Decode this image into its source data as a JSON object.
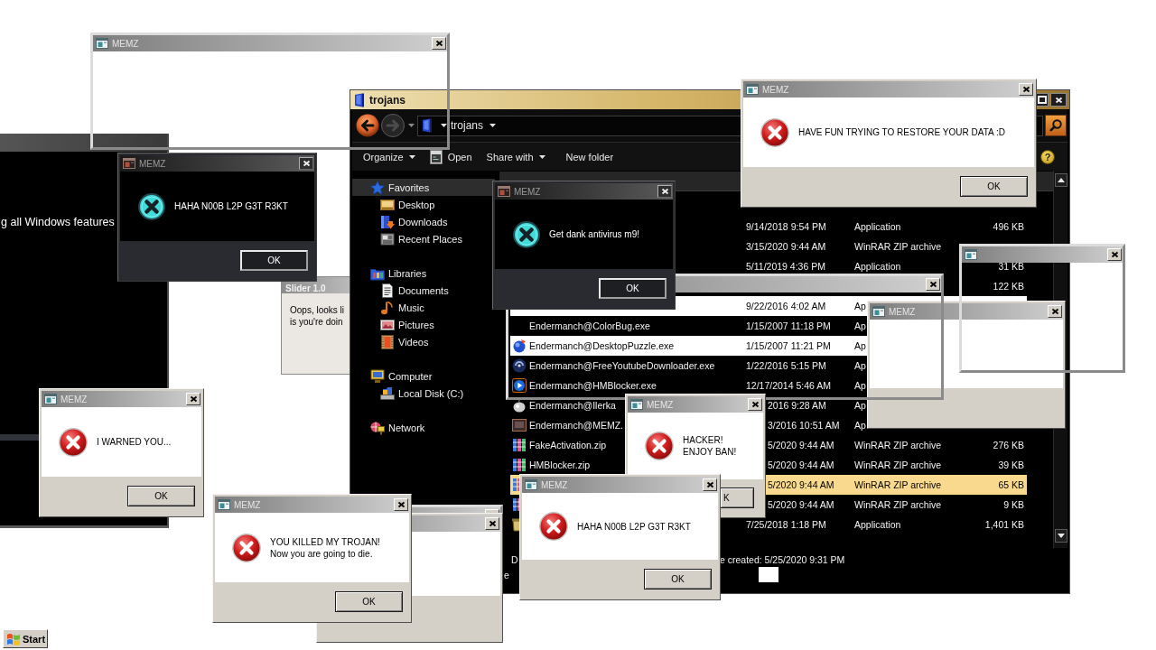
{
  "desktop": {
    "windows": [
      {
        "kind": "console",
        "text": "g all Windows features"
      },
      {
        "kind": "slider",
        "title": "Slider 1.0",
        "lines": [
          "Oops, looks li",
          "is you're doin"
        ]
      },
      {
        "kind": "explorer",
        "title": "trojans",
        "address": "trojans",
        "commands": [
          {
            "label": "Organize",
            "kind": "menu"
          },
          {
            "label": "Open",
            "kind": "action"
          },
          {
            "label": "Share with",
            "kind": "menu"
          },
          {
            "label": "New folder",
            "kind": "plain"
          }
        ],
        "help": "?",
        "navigation": [
          {
            "label": "Favorites",
            "selected": true,
            "children": [
              {
                "label": "Desktop",
                "selected": false
              },
              {
                "label": "Downloads",
                "selected": false
              },
              {
                "label": "Recent Places",
                "selected": false
              }
            ]
          },
          {
            "label": "Libraries",
            "selected": false,
            "children": [
              {
                "label": "Documents",
                "selected": false
              },
              {
                "label": "Music",
                "selected": false
              },
              {
                "label": "Pictures",
                "selected": false
              },
              {
                "label": "Videos",
                "selected": false
              }
            ]
          },
          {
            "label": "Computer",
            "selected": false,
            "children": [
              {
                "label": "Local Disk (C:)",
                "selected": false
              }
            ]
          },
          {
            "label": "Network",
            "selected": false
          }
        ],
        "rows": [
          {
            "kind": "plain",
            "selected": false,
            "glitched": false,
            "column_2": "9/14/2018 9:54 PM",
            "column_3": "Application",
            "column_4": "496 KB"
          },
          {
            "kind": "plain",
            "selected": false,
            "glitched": false,
            "column_2": "3/15/2020 9:44 AM",
            "column_3": "WinRAR ZIP archive"
          },
          {
            "kind": "plain",
            "selected": false,
            "glitched": false,
            "column_2": "5/11/2019 4:36 PM",
            "column_3": "Application",
            "column_4": "31 KB"
          },
          {
            "kind": "plain",
            "selected": false,
            "glitched": false,
            "column_4": "122 KB"
          },
          {
            "kind": "plain",
            "selected": false,
            "glitched": true,
            "column_2": "9/22/2016 4:02 AM",
            "column_3": "Ap"
          },
          {
            "kind": "plain",
            "selected": false,
            "glitched": false,
            "column_1": "Endermanch@ColorBug.exe",
            "column_2": "1/15/2007 11:18 PM",
            "column_3": "Ap"
          },
          {
            "kind": "app",
            "selected": false,
            "glitched": true,
            "column_1": "Endermanch@DesktopPuzzle.exe",
            "column_2": "1/15/2007 11:21 PM",
            "column_3": "Ap"
          },
          {
            "kind": "app",
            "selected": false,
            "glitched": false,
            "column_1": "Endermanch@FreeYoutubeDownloader.exe",
            "column_2": "1/22/2016 5:15 PM",
            "column_3": "Ap"
          },
          {
            "kind": "app",
            "selected": false,
            "glitched": false,
            "column_1": "Endermanch@HMBlocker.exe",
            "column_2": "12/17/2014 5:46 AM",
            "column_3": "Ap"
          },
          {
            "kind": "app",
            "selected": false,
            "glitched": false,
            "column_1": "Endermanch@Ilerka",
            "column_2": "2016 9:28 AM",
            "column_3": "Ap"
          },
          {
            "kind": "app",
            "selected": false,
            "glitched": false,
            "column_1": "Endermanch@MEMZ.",
            "column_2": "3/2016 10:51 AM",
            "column_3": "Ap"
          },
          {
            "kind": "archive",
            "selected": false,
            "glitched": false,
            "column_1": "FakeActivation.zip",
            "column_2": "5/2020 9:44 AM",
            "column_3": "WinRAR ZIP archive",
            "column_4": "276 KB"
          },
          {
            "kind": "archive",
            "selected": false,
            "glitched": false,
            "column_1": "HMBlocker.zip",
            "column_2": "5/2020 9:44 AM",
            "column_3": "WinRAR ZIP archive",
            "column_4": "39 KB"
          },
          {
            "kind": "archive",
            "selected": true,
            "glitched": false,
            "column_2": "5/2020 9:44 AM",
            "column_3": "WinRAR ZIP archive",
            "column_4": "65 KB"
          },
          {
            "kind": "archive",
            "selected": false,
            "glitched": false,
            "column_2": "5/2020 9:44 AM",
            "column_3": "WinRAR ZIP archive",
            "column_4": "9 KB"
          },
          {
            "kind": "app",
            "selected": false,
            "glitched": false,
            "column_2": "7/25/2018 1:18 PM",
            "column_3": "Application",
            "column_4": "1,401 KB"
          }
        ],
        "details": {
          "left_1": "D",
          "right_1": "e created: 5/25/2020 9:31 PM",
          "left_2": "e"
        }
      },
      {
        "kind": "blank",
        "title": "MEMZ",
        "icon": true
      },
      {
        "kind": "frame"
      },
      {
        "kind": "frame",
        "icon": true
      },
      {
        "kind": "message",
        "dark": true,
        "title": "MEMZ",
        "lines": [
          "Get dank antivirus m9!"
        ],
        "button": "OK"
      },
      {
        "kind": "message",
        "dark": false,
        "title": "MEMZ",
        "lines": [
          "HAVE FUN TRYING TO RESTORE YOUR DATA :D"
        ],
        "button": "OK"
      },
      {
        "kind": "message",
        "dark": true,
        "title": "MEMZ",
        "lines": [
          "HAHA N00B L2P G3T R3KT"
        ],
        "button": "OK"
      },
      {
        "kind": "frame",
        "title": "MEMZ",
        "icon": true
      },
      {
        "kind": "message",
        "dark": false,
        "title": "MEMZ",
        "lines": [
          "I WARNED YOU..."
        ],
        "button": "OK"
      },
      {
        "kind": "message",
        "dark": false,
        "title": "MEMZ",
        "lines": [
          "HACKER!",
          "ENJOY BAN!"
        ],
        "button": "K"
      },
      {
        "kind": "frame"
      },
      {
        "kind": "blank"
      },
      {
        "kind": "message",
        "dark": false,
        "title": "MEMZ",
        "lines": [
          "YOU KILLED MY TROJAN!",
          "Now you are going to die."
        ],
        "button": "OK"
      },
      {
        "kind": "message",
        "dark": false,
        "title": "MEMZ",
        "lines": [
          "HAHA N00B L2P G3T R3KT"
        ],
        "button": "OK"
      }
    ]
  },
  "taskbar": {
    "start_button": "Start"
  }
}
